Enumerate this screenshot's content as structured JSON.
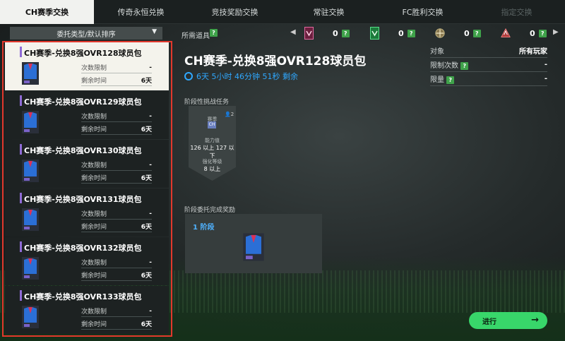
{
  "tabs": [
    {
      "label": "CH赛季交换"
    },
    {
      "label": "传奇永恒兑换"
    },
    {
      "label": "竞技奖励交换"
    },
    {
      "label": "常驻交换"
    },
    {
      "label": "FC胜利交换"
    },
    {
      "label": "指定交换"
    }
  ],
  "toolbar": {
    "sort_label": "委托类型/默认排序",
    "sort_arrow": "▼",
    "required_items_label": "所需道具",
    "help": "?",
    "items": [
      {
        "icon": "pink-card-icon",
        "count": "0"
      },
      {
        "icon": "green-card-icon",
        "count": "0"
      },
      {
        "icon": "gold-token-icon",
        "count": "0"
      },
      {
        "icon": "red-token-icon",
        "count": "0"
      }
    ]
  },
  "list": [
    {
      "title": "CH赛季-兑换8强OVR128球员包",
      "limit_label": "次数限制",
      "limit_value": "-",
      "remain_label": "剩余时间",
      "remain_value": "6天",
      "ovr": "128"
    },
    {
      "title": "CH赛季-兑换8强OVR129球员包",
      "limit_label": "次数限制",
      "limit_value": "-",
      "remain_label": "剩余时间",
      "remain_value": "6天",
      "ovr": "129"
    },
    {
      "title": "CH赛季-兑换8强OVR130球员包",
      "limit_label": "次数限制",
      "limit_value": "-",
      "remain_label": "剩余时间",
      "remain_value": "6天",
      "ovr": "130"
    },
    {
      "title": "CH赛季-兑换8强OVR131球员包",
      "limit_label": "次数限制",
      "limit_value": "-",
      "remain_label": "剩余时间",
      "remain_value": "6天",
      "ovr": "131"
    },
    {
      "title": "CH赛季-兑换8强OVR132球员包",
      "limit_label": "次数限制",
      "limit_value": "-",
      "remain_label": "剩余时间",
      "remain_value": "6天",
      "ovr": "132"
    },
    {
      "title": "CH赛季-兑换8强OVR133球员包",
      "limit_label": "次数限制",
      "limit_value": "-",
      "remain_label": "剩余时间",
      "remain_value": "6天",
      "ovr": "133"
    }
  ],
  "detail": {
    "title": "CH赛季-兑换8强OVR128球员包",
    "timer": "6天 5小时 46分钟 51秒 剩余",
    "info": [
      {
        "label": "对象",
        "value": "所有玩家"
      },
      {
        "label": "限制次数",
        "value": "-"
      },
      {
        "label": "限量",
        "value": "-"
      }
    ],
    "mission_section": "阶段性挑战任务",
    "mission": {
      "season_label": "赛季",
      "season_badge": "CH",
      "person_count": "2",
      "ability_label": "能力值",
      "ability_value": "126 以上 127 以下",
      "enhance_label": "强化等级",
      "enhance_value": "8 以上"
    },
    "reward_section": "阶段委托完成奖励",
    "reward_stage": "1 阶段",
    "action_label": "进行",
    "action_arrow": "→"
  },
  "colors": {
    "accent_green": "#38d66a",
    "accent_blue": "#2fa8ff",
    "selected_bg": "#f4f3ec",
    "highlight_frame": "#e2382c"
  }
}
